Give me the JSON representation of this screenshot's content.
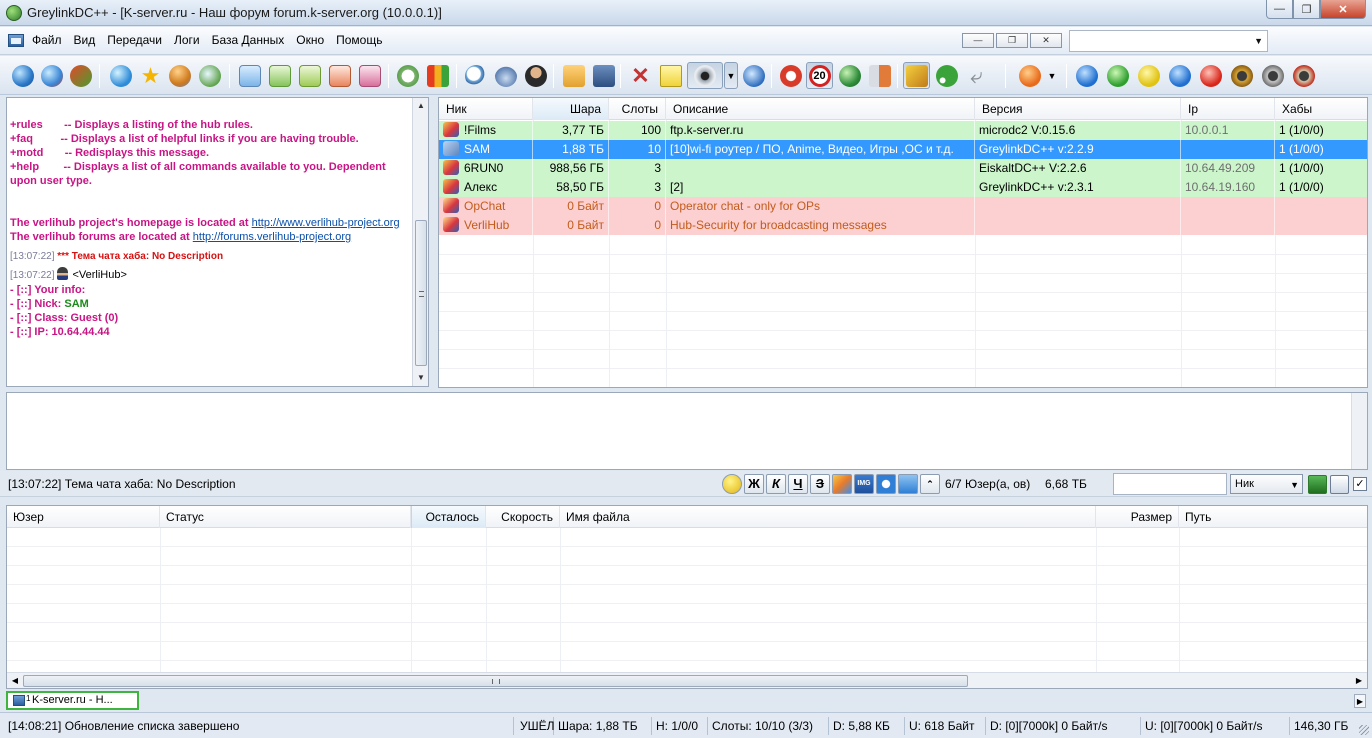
{
  "window": {
    "title": "GreylinkDC++ - [K-server.ru -  Наш форум forum.k-server.org (10.0.0.1)]"
  },
  "menu": {
    "items": [
      "Файл",
      "Вид",
      "Передачи",
      "Логи",
      "База Данных",
      "Окно",
      "Помощь"
    ]
  },
  "chat": {
    "lines": [
      {
        "cmd": "+rules",
        "desc": "-- Displays a listing of the hub rules."
      },
      {
        "cmd": "+faq",
        "desc": "-- Displays a list of helpful links if you are having trouble."
      },
      {
        "cmd": "+motd",
        "desc": "-- Redisplays this message."
      },
      {
        "cmd": "+help",
        "desc": "-- Displays a list of all commands available to you. Dependent upon user type."
      }
    ],
    "homepage_text": "The verlihub project's homepage is located at ",
    "homepage_link": "http://www.verlihub-project.org",
    "forums_text": "The verlihub forums are located at ",
    "forums_link": "http://forums.verlihub-project.org",
    "topic_ts": "[13:07:22]",
    "topic_msg": "*** Тема чата хаба: No Description",
    "msg_ts": "[13:07:22]",
    "msg_user": "<VerliHub>",
    "info_lines": [
      {
        "label": "- [::] Your info:",
        "value": ""
      },
      {
        "label": "- [::] Nick: ",
        "value": "SAM"
      },
      {
        "label": "- [::] Class: Guest (0)",
        "value": ""
      },
      {
        "label": "- [::] IP: 10.64.44.44",
        "value": ""
      }
    ]
  },
  "userlist": {
    "columns": [
      "Ник",
      "Шара",
      "Слоты",
      "Описание",
      "Версия",
      "Ip",
      "Хабы"
    ],
    "rows": [
      {
        "nick": "!Films",
        "share": "3,77 ТБ",
        "slots": "100",
        "desc": "ftp.k-server.ru",
        "version": "microdc2 V:0.15.6",
        "ip": "10.0.0.1",
        "hubs": "1 (1/0/0)",
        "style": "green"
      },
      {
        "nick": "SAM",
        "share": "1,88 ТБ",
        "slots": "10",
        "desc": "[10]wi-fi роутер / ПО, Anime, Видео, Игры ,ОС и т.д.",
        "version": "GreylinkDC++ v:2.2.9",
        "ip": "",
        "hubs": "1 (1/0/0)",
        "style": "sel"
      },
      {
        "nick": "6RUN0",
        "share": "988,56 ГБ",
        "slots": "3",
        "desc": "",
        "version": "EiskaltDC++ V:2.2.6",
        "ip": "10.64.49.209",
        "hubs": "1 (1/0/0)",
        "style": "green"
      },
      {
        "nick": "Алекс",
        "share": "58,50 ГБ",
        "slots": "3",
        "desc": "[2]",
        "version": "GreylinkDC++ v:2.3.1",
        "ip": "10.64.19.160",
        "hubs": "1 (1/0/0)",
        "style": "green"
      },
      {
        "nick": "OpChat",
        "share": "0 Байт",
        "slots": "0",
        "desc": "Operator chat - only for OPs",
        "version": "",
        "ip": "",
        "hubs": "",
        "style": "pink op"
      },
      {
        "nick": "VerliHub",
        "share": "0 Байт",
        "slots": "0",
        "desc": "Hub-Security for broadcasting messages",
        "version": "",
        "ip": "",
        "hubs": "",
        "style": "pink op"
      }
    ]
  },
  "chat_status": {
    "topic": "[13:07:22] Тема чата хаба: No Description",
    "format_buttons": [
      "Ж",
      "К",
      "Ч",
      "З"
    ],
    "users": "6/7 Юзер(а, ов)",
    "share": "6,68 ТБ",
    "search_by": "Ник"
  },
  "transfers": {
    "columns": [
      "Юзер",
      "Статус",
      "Осталось",
      "Скорость",
      "Имя файла",
      "Размер",
      "Путь"
    ]
  },
  "tabs": [
    {
      "num": "1",
      "label": "K-server.ru -  Н..."
    }
  ],
  "statusbar": {
    "message": "[14:08:21] Обновление списка завершено",
    "away": "УШЁЛ",
    "share": "Шара: 1,88 ТБ",
    "hubs": "H: 1/0/0",
    "slots": "Слоты: 10/10 (3/3)",
    "down": "D: 5,88 КБ",
    "up": "U: 618 Байт",
    "down_rate": "D: [0][7000k] 0 Байт/s",
    "up_rate": "U: [0][7000k] 0 Байт/s",
    "total": "146,30 ГБ"
  },
  "colors": {
    "user_green": "#ccf5cc",
    "user_pink": "#fcd0d0",
    "selection": "#3399ff",
    "chat_magenta": "#c71585"
  }
}
